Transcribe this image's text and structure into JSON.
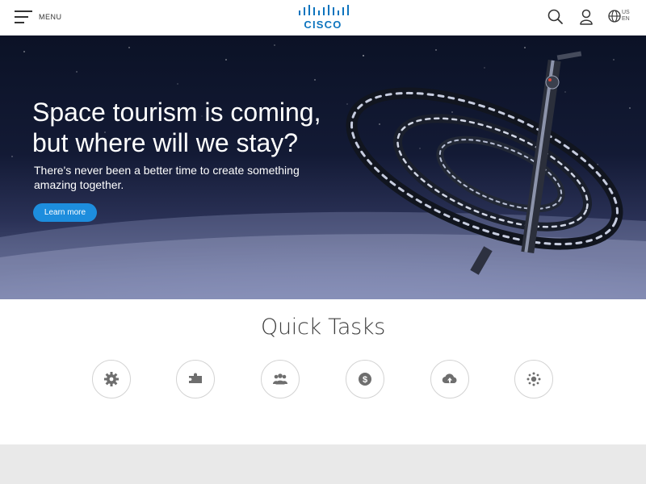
{
  "header": {
    "menu_label": "MENU",
    "logo_text": "CISCO",
    "locale_region": "US",
    "locale_lang": "EN"
  },
  "hero": {
    "title_line1": "Space tourism is coming,",
    "title_line2": "but where will we stay?",
    "subtitle_line1": "There's never been a better time to create something",
    "subtitle_line2": "amazing together.",
    "cta_label": "Learn more"
  },
  "quick_tasks": {
    "title": "Quick Tasks",
    "items": [
      {
        "icon": "gear-icon"
      },
      {
        "icon": "puzzle-icon"
      },
      {
        "icon": "users-icon"
      },
      {
        "icon": "dollar-icon"
      },
      {
        "icon": "cloud-upload-icon"
      },
      {
        "icon": "hub-icon"
      }
    ]
  },
  "colors": {
    "brand_blue": "#0d74be",
    "cta_blue": "#1d8ddd",
    "icon_gray": "#6e6e6e",
    "footer_gray": "#e9e9e9"
  }
}
